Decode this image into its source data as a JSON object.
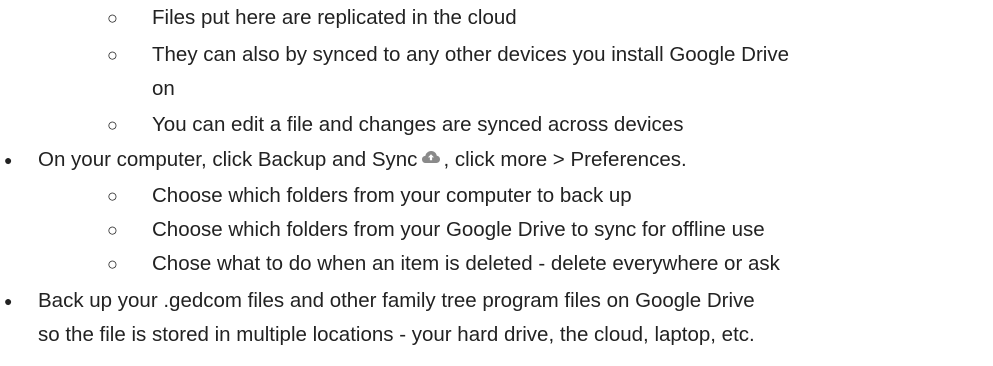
{
  "markers": {
    "hollow": "○",
    "filled": "●"
  },
  "lines": {
    "l1": "Files put here are replicated in the cloud",
    "l2a": "They can also by synced to any other devices you install Google Drive",
    "l2b": "on",
    "l3": "You can edit a file and changes are synced across devices",
    "l4a": "On your computer, click Backup and Sync",
    "l4b": ", click more > Preferences.",
    "l5": "Choose which folders from your computer to back up",
    "l6": "Choose which folders from your Google Drive to sync for offline use",
    "l7": "Chose what to do when an item is deleted - delete everywhere or ask",
    "l8a": "Back up your .gedcom files and other family tree program files on Google Drive",
    "l8b": "so the file is stored in multiple locations - your hard drive, the cloud, laptop, etc."
  },
  "icons": {
    "backup_sync": "cloud-upload-icon"
  },
  "colors": {
    "text": "#222222",
    "icon": "#8a8a8a"
  }
}
